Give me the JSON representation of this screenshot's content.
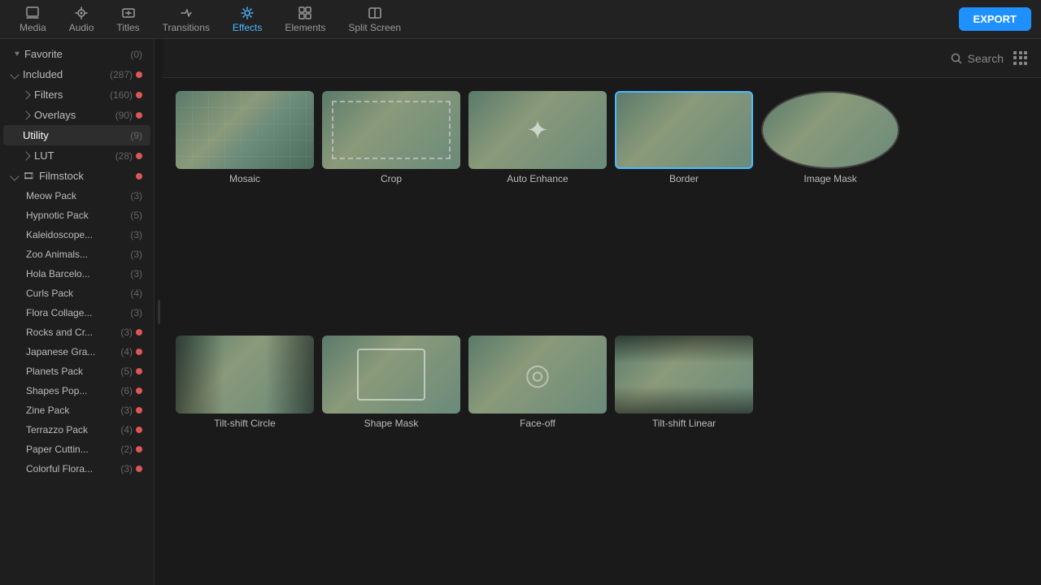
{
  "app": {
    "export_label": "EXPORT"
  },
  "nav": {
    "items": [
      {
        "id": "media",
        "label": "Media",
        "icon": "📁",
        "active": false
      },
      {
        "id": "audio",
        "label": "Audio",
        "icon": "🎵",
        "active": false
      },
      {
        "id": "titles",
        "label": "Titles",
        "icon": "T",
        "active": false
      },
      {
        "id": "transitions",
        "label": "Transitions",
        "icon": "↔",
        "active": false
      },
      {
        "id": "effects",
        "label": "Effects",
        "icon": "✦",
        "active": true
      },
      {
        "id": "elements",
        "label": "Elements",
        "icon": "▣",
        "active": false
      },
      {
        "id": "split_screen",
        "label": "Split Screen",
        "icon": "⊞",
        "active": false
      }
    ]
  },
  "sidebar": {
    "favorite": {
      "label": "Favorite",
      "count": "(0)"
    },
    "included": {
      "label": "Included",
      "count": "(287)",
      "expanded": true
    },
    "filters": {
      "label": "Filters",
      "count": "(160)"
    },
    "overlays": {
      "label": "Overlays",
      "count": "(90)"
    },
    "utility": {
      "label": "Utility",
      "count": "(9)",
      "active": true
    },
    "lut": {
      "label": "LUT",
      "count": "(28)"
    },
    "filmstock": {
      "label": "Filmstock",
      "expanded": true,
      "packs": [
        {
          "label": "Meow Pack",
          "count": "(3)",
          "dot": false
        },
        {
          "label": "Hypnotic Pack",
          "count": "(5)",
          "dot": false
        },
        {
          "label": "Kaleidoscope...",
          "count": "(3)",
          "dot": false
        },
        {
          "label": "Zoo Animals...",
          "count": "(3)",
          "dot": false
        },
        {
          "label": "Hola Barcelo...",
          "count": "(3)",
          "dot": false
        },
        {
          "label": "Curls Pack",
          "count": "(4)",
          "dot": false
        },
        {
          "label": "Flora Collage...",
          "count": "(3)",
          "dot": false
        },
        {
          "label": "Rocks and Cr...",
          "count": "(3)",
          "dot": true
        },
        {
          "label": "Japanese Gra...",
          "count": "(4)",
          "dot": true
        },
        {
          "label": "Planets Pack",
          "count": "(5)",
          "dot": true
        },
        {
          "label": "Shapes Pop...",
          "count": "(6)",
          "dot": true
        },
        {
          "label": "Zine Pack",
          "count": "(3)",
          "dot": true
        },
        {
          "label": "Terrazzo Pack",
          "count": "(4)",
          "dot": true
        },
        {
          "label": "Paper Cuttin...",
          "count": "(2)",
          "dot": true
        },
        {
          "label": "Colorful Flora...",
          "count": "(3)",
          "dot": true
        }
      ]
    }
  },
  "panel": {
    "search_label": "Search",
    "effects": [
      {
        "id": "mosaic",
        "label": "Mosaic",
        "thumb_class": "thumb-mosaic",
        "border": false
      },
      {
        "id": "crop",
        "label": "Crop",
        "thumb_class": "thumb-crop",
        "border": false
      },
      {
        "id": "auto_enhance",
        "label": "Auto Enhance",
        "thumb_class": "thumb-auto-enhance",
        "border": false
      },
      {
        "id": "border",
        "label": "Border",
        "thumb_class": "thumb-border",
        "border": true
      },
      {
        "id": "image_mask",
        "label": "Image Mask",
        "thumb_class": "thumb-image-mask",
        "border": false
      },
      {
        "id": "tiltshift_circle",
        "label": "Tilt-shift Circle",
        "thumb_class": "thumb-tiltshift-circle",
        "border": false
      },
      {
        "id": "shape_mask",
        "label": "Shape Mask",
        "thumb_class": "thumb-shape-mask",
        "border": false
      },
      {
        "id": "faceoff",
        "label": "Face-off",
        "thumb_class": "thumb-faceoff",
        "border": false
      },
      {
        "id": "tiltshift_linear",
        "label": "Tilt-shift Linear",
        "thumb_class": "thumb-tiltshift-linear",
        "border": false
      }
    ]
  }
}
